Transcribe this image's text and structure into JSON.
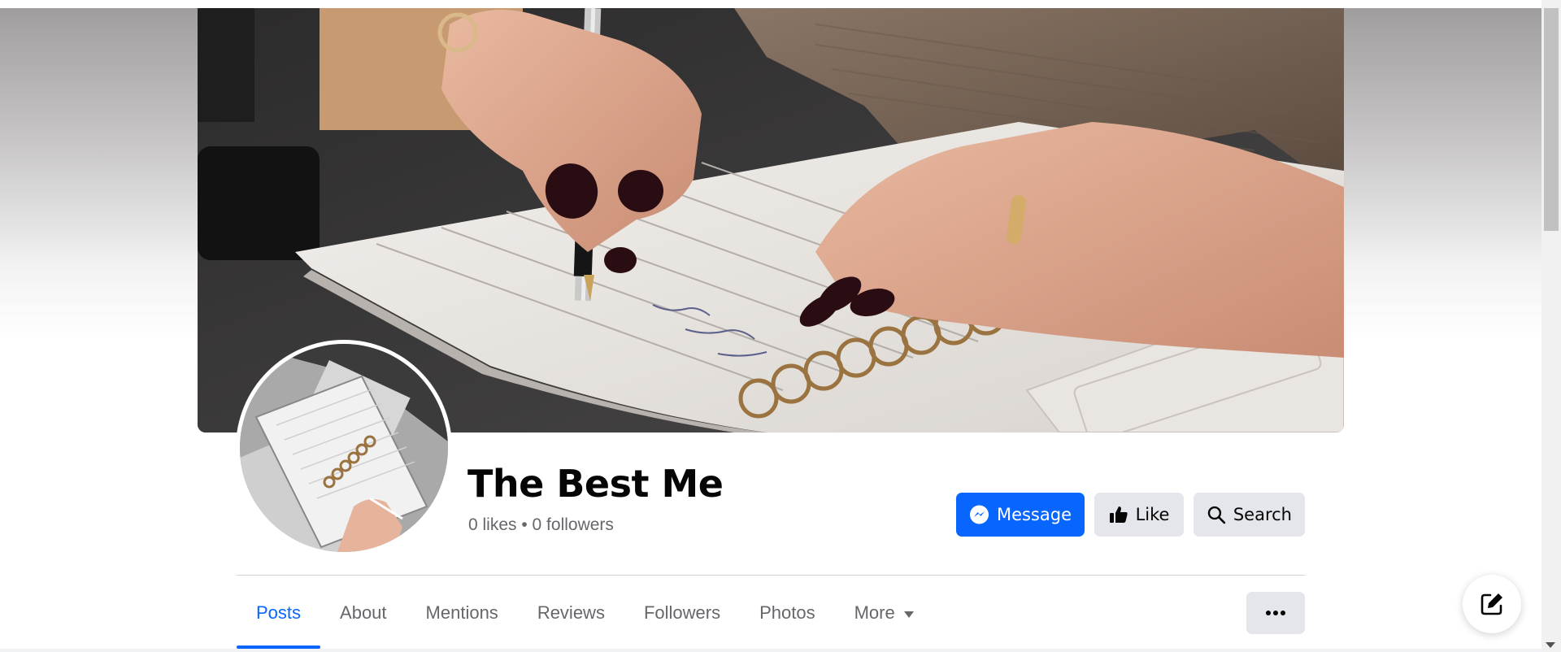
{
  "page": {
    "name": "The Best Me",
    "stats": "0 likes • 0 followers"
  },
  "actions": {
    "message_label": "Message",
    "like_label": "Like",
    "search_label": "Search"
  },
  "tabs": [
    {
      "label": "Posts",
      "active": true
    },
    {
      "label": "About",
      "active": false
    },
    {
      "label": "Mentions",
      "active": false
    },
    {
      "label": "Reviews",
      "active": false
    },
    {
      "label": "Followers",
      "active": false
    },
    {
      "label": "Photos",
      "active": false
    },
    {
      "label": "More",
      "active": false
    }
  ],
  "icons": {
    "message": "messenger-icon",
    "like": "thumbs-up-icon",
    "search": "search-icon",
    "more": "caret-down-icon",
    "overflow": "ellipsis-icon",
    "compose": "compose-icon"
  },
  "colors": {
    "accent": "#0866ff",
    "secondary_button": "#e4e6eb",
    "muted_text": "#65676b"
  }
}
